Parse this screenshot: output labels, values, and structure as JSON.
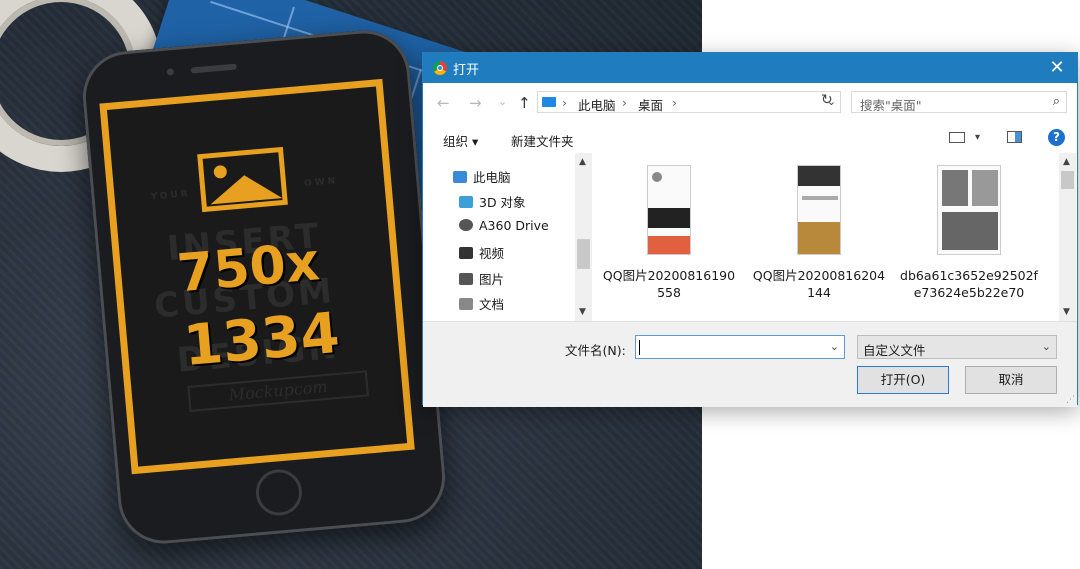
{
  "background": {
    "phone_screen": {
      "ghost_line_1": "YOUR",
      "ghost_line_2": "OWN",
      "ghost_line_3": "INSERT",
      "ghost_line_4": "CUSTOM",
      "ghost_line_5": "DESIGN",
      "size_line_1": "750x",
      "size_line_2": "1334",
      "script_text": "Mockupcom"
    }
  },
  "dialog": {
    "title": "打开",
    "close_glyph": "✕",
    "nav": {
      "back": "←",
      "forward": "→",
      "recent": "⌄",
      "up": "↑"
    },
    "address": {
      "sep1": "›",
      "crumb1": "此电脑",
      "sep2": "›",
      "crumb2": "桌面",
      "sep3": "›",
      "drop": "⌄"
    },
    "refresh": "↻",
    "search_placeholder": "搜索\"桌面\"",
    "search_icon": "⌕",
    "toolbar": {
      "organize": "组织 ▾",
      "new_folder": "新建文件夹",
      "view_drop": "▾",
      "help": "?"
    },
    "nav_pane": [
      {
        "label": "此电脑",
        "icon": "computer-icon",
        "color": "#3b8ad8"
      },
      {
        "label": "3D 对象",
        "icon": "cube-icon",
        "color": "#39a0d8"
      },
      {
        "label": "A360 Drive",
        "icon": "cloud-drive-icon",
        "color": "#555555"
      },
      {
        "label": "视频",
        "icon": "video-icon",
        "color": "#333333"
      },
      {
        "label": "图片",
        "icon": "picture-icon",
        "color": "#555555"
      },
      {
        "label": "文档",
        "icon": "document-icon",
        "color": "#888888"
      }
    ],
    "files": [
      {
        "name": "QQ图片20200816190558",
        "icon": "image-file-thumbnail"
      },
      {
        "name": "QQ图片20200816204144",
        "icon": "image-file-thumbnail"
      },
      {
        "name": "db6a61c3652e92502fe73624e5b22e70",
        "icon": "image-file-thumbnail"
      }
    ],
    "footer": {
      "filename_label": "文件名(N):",
      "filename_value": "",
      "filetype": "自定义文件",
      "open_button": "打开(O)",
      "cancel_button": "取消"
    },
    "colors": {
      "titlebar": "#1f7cbf",
      "accent": "#2b7bd5"
    }
  }
}
